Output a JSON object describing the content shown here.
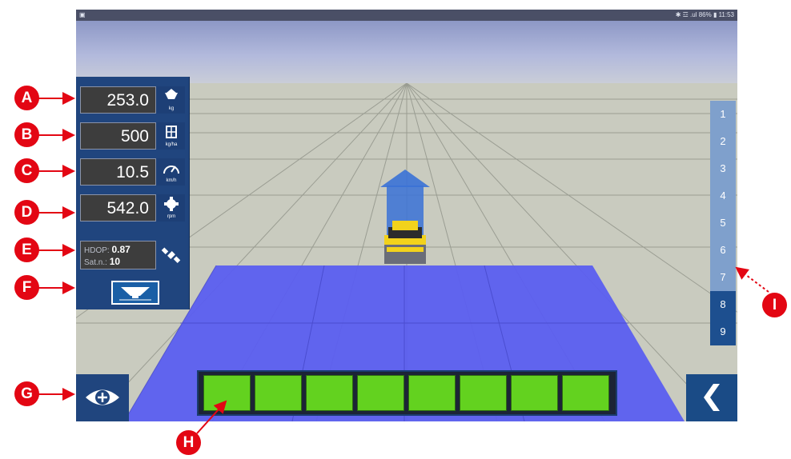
{
  "statusbar": {
    "left_icon": "image-icon",
    "right_text": "✱ ☲ .ul 86% ▮ 11:53"
  },
  "gauges": [
    {
      "value": "253.0",
      "unit": "kg",
      "icon": "scale-icon"
    },
    {
      "value": "500",
      "unit": "kg/ha",
      "icon": "rate-icon"
    },
    {
      "value": "10.5",
      "unit": "km/h",
      "icon": "speedometer-icon"
    },
    {
      "value": "542.0",
      "unit": "rpm",
      "icon": "gear-icon"
    }
  ],
  "gps": {
    "hdop_label": "HDOP",
    "hdop_value": "0.87",
    "sat_label": "Sat.n.:",
    "sat_value": "10",
    "icon": "satellite-icon"
  },
  "rows": [
    "1",
    "2",
    "3",
    "4",
    "5",
    "6",
    "7",
    "8",
    "9"
  ],
  "active_rows": [
    8,
    9
  ],
  "sections": {
    "count": 8,
    "color": "#63d21f",
    "state": "all-on"
  },
  "callouts": [
    "A",
    "B",
    "C",
    "D",
    "E",
    "F",
    "G",
    "H",
    "I"
  ],
  "colors": {
    "panel": "#20457e",
    "coverage": "#5b5ef0",
    "callout": "#e30613",
    "arrow": "#3a72d6"
  }
}
